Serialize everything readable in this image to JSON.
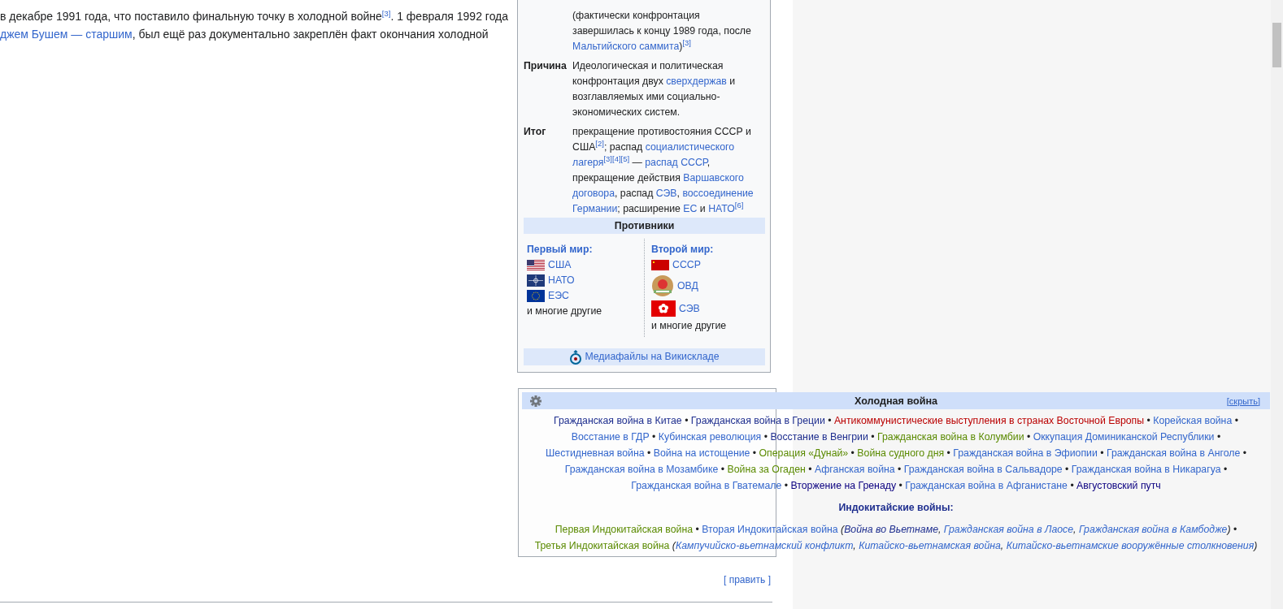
{
  "article": {
    "lines": [
      [
        {
          "kind": "text",
          "text": "в декабре 1991 года, что поставило финальную точку в холодной войне"
        },
        {
          "kind": "ref",
          "text": "[3]"
        },
        {
          "kind": "text",
          "text": ". 1 февраля 1992 года"
        }
      ],
      [
        {
          "kind": "link",
          "text": "джем Бушем — старшим"
        },
        {
          "kind": "text",
          "text": ", был ещё раз документально закреплён факт окончания холодной"
        }
      ]
    ]
  },
  "infobox": {
    "rows": [
      {
        "runs": [
          {
            "kind": "text",
            "text": "(фактически конфронтация завершилась к концу 1989 года, после "
          },
          {
            "kind": "link",
            "text": "Мальтийского саммита"
          },
          {
            "kind": "text",
            "text": ")"
          },
          {
            "kind": "ref",
            "text": "[3]"
          }
        ]
      },
      {
        "label": "Причина",
        "runs": [
          {
            "kind": "text",
            "text": "Идеологическая и политическая конфронтация двух "
          },
          {
            "kind": "link",
            "text": "сверхдержав"
          },
          {
            "kind": "text",
            "text": " и возглавляемых ими социально-экономических систем."
          }
        ]
      },
      {
        "label": "Итог",
        "runs": [
          {
            "kind": "text",
            "text": "прекращение противостояния СССР и США"
          },
          {
            "kind": "ref",
            "text": "[2]"
          },
          {
            "kind": "text",
            "text": "; распад "
          },
          {
            "kind": "link",
            "text": "социалистического "
          },
          {
            "kind": "link",
            "text": "лагеря"
          },
          {
            "kind": "ref",
            "text": "[3]"
          },
          {
            "kind": "ref",
            "text": "[4]"
          },
          {
            "kind": "ref",
            "text": "[5]"
          },
          {
            "kind": "text",
            "text": " — "
          },
          {
            "kind": "link",
            "text": "распад СССР"
          },
          {
            "kind": "text",
            "text": ", прекращение действия "
          },
          {
            "kind": "link",
            "text": "Варшавского "
          },
          {
            "kind": "link",
            "text": "договора"
          },
          {
            "kind": "text",
            "text": ", распад "
          },
          {
            "kind": "link",
            "text": "СЭВ"
          },
          {
            "kind": "text",
            "text": ", "
          },
          {
            "kind": "link",
            "text": "воссоединение "
          },
          {
            "kind": "link",
            "text": "Германии"
          },
          {
            "kind": "text",
            "text": "; расширение "
          },
          {
            "kind": "link",
            "text": "ЕС"
          },
          {
            "kind": "text",
            "text": " и "
          },
          {
            "kind": "link",
            "text": "НАТО"
          },
          {
            "kind": "ref",
            "text": "[6]"
          }
        ]
      }
    ],
    "opponents": {
      "title": "Противники",
      "sides": [
        {
          "heading": "Первый мир:",
          "items": [
            {
              "name": "США",
              "kind": "stripes"
            },
            {
              "name": "НАТО",
              "kind": "compass"
            },
            {
              "name": "ЕЭС",
              "kind": "stars"
            }
          ],
          "note": "и многие другие"
        },
        {
          "heading": "Второй мир:",
          "items": [
            {
              "name": "СССР",
              "kind": "red"
            },
            {
              "name": "ОВД",
              "kind": "emblem"
            },
            {
              "name": "СЭВ",
              "kind": "flower"
            }
          ],
          "note": "и многие другие"
        }
      ]
    },
    "media": {
      "label": "Медиафайлы на Викискладе"
    }
  },
  "navbox": {
    "title": "Холодная война",
    "toggle": "[скрыть]",
    "lines": [
      [
        {
          "kind": "link",
          "text": "Гражданская война в Китае",
          "color": "#1f2f8f"
        },
        {
          "kind": "text",
          "text": " • "
        },
        {
          "kind": "link",
          "text": "Гражданская война в Греции",
          "color": "#1f2f8f"
        },
        {
          "kind": "text",
          "text": " • "
        },
        {
          "kind": "link",
          "text": "Антикоммунистические выступления в странах Восточной Европы",
          "color": "#ba0000"
        },
        {
          "kind": "text",
          "text": " • "
        },
        {
          "kind": "link",
          "text": "Корейская война",
          "color": "#3366cc"
        },
        {
          "kind": "text",
          "text": " •"
        }
      ],
      [
        {
          "kind": "link",
          "text": "Восстание в ГДР",
          "color": "#3366cc"
        },
        {
          "kind": "text",
          "text": " • "
        },
        {
          "kind": "link",
          "text": "Кубинская революция",
          "color": "#3366cc"
        },
        {
          "kind": "text",
          "text": " • "
        },
        {
          "kind": "link",
          "text": "Восстание в Венгрии",
          "color": "#1f2f8f"
        },
        {
          "kind": "text",
          "text": " • "
        },
        {
          "kind": "link",
          "text": "Гражданская война в Колумбии",
          "color": "#5a8a00"
        },
        {
          "kind": "text",
          "text": " • "
        },
        {
          "kind": "link",
          "text": "Оккупация Доминиканской Республики",
          "color": "#3366cc"
        },
        {
          "kind": "text",
          "text": " •"
        }
      ],
      [
        {
          "kind": "link",
          "text": "Шестидневная война",
          "color": "#3366cc"
        },
        {
          "kind": "text",
          "text": " • "
        },
        {
          "kind": "link",
          "text": "Война на истощение",
          "color": "#3366cc"
        },
        {
          "kind": "text",
          "text": " • "
        },
        {
          "kind": "link",
          "text": "Операция «Дунай»",
          "color": "#5a8a00"
        },
        {
          "kind": "text",
          "text": " • "
        },
        {
          "kind": "link",
          "text": "Война судного дня",
          "color": "#5a8a00"
        },
        {
          "kind": "text",
          "text": " • "
        },
        {
          "kind": "link",
          "text": "Гражданская война в Эфиопии",
          "color": "#3366cc"
        },
        {
          "kind": "text",
          "text": " • "
        },
        {
          "kind": "link",
          "text": "Гражданская война в Анголе",
          "color": "#3366cc"
        },
        {
          "kind": "text",
          "text": " •"
        }
      ],
      [
        {
          "kind": "link",
          "text": "Гражданская война в Мозамбике",
          "color": "#3366cc"
        },
        {
          "kind": "text",
          "text": " • "
        },
        {
          "kind": "link",
          "text": "Война за Огаден",
          "color": "#5a8a00"
        },
        {
          "kind": "text",
          "text": " • "
        },
        {
          "kind": "link",
          "text": "Афганская война",
          "color": "#3366cc"
        },
        {
          "kind": "text",
          "text": " • "
        },
        {
          "kind": "link",
          "text": "Гражданская война в Сальвадоре",
          "color": "#3366cc"
        },
        {
          "kind": "text",
          "text": " • "
        },
        {
          "kind": "link",
          "text": "Гражданская война в Никарагуа",
          "color": "#3366cc"
        },
        {
          "kind": "text",
          "text": " •"
        }
      ],
      [
        {
          "kind": "link",
          "text": "Гражданская война в Гватемале",
          "color": "#3366cc"
        },
        {
          "kind": "text",
          "text": " • "
        },
        {
          "kind": "link",
          "text": "Вторжение на Гренаду",
          "color": "#0b0080"
        },
        {
          "kind": "text",
          "text": " • "
        },
        {
          "kind": "link",
          "text": "Гражданская война в Афганистане",
          "color": "#3366cc"
        },
        {
          "kind": "text",
          "text": " • "
        },
        {
          "kind": "link",
          "text": "Августовский путч",
          "color": "#0b0080"
        }
      ]
    ],
    "sections": [
      {
        "heading": "Индокитайские войны:",
        "lines": [
          [
            {
              "kind": "link",
              "text": "Первая Индокитайская война",
              "color": "#5a8a00"
            },
            {
              "kind": "text",
              "text": " • "
            },
            {
              "kind": "link",
              "text": "Вторая Индокитайская война",
              "color": "#3366cc"
            },
            {
              "kind": "note",
              "text": " ("
            },
            {
              "kind": "sublink",
              "text": "Война во Вьетнаме",
              "color": "#1f2f8f"
            },
            {
              "kind": "note",
              "text": ", "
            },
            {
              "kind": "sublink",
              "text": "Гражданская война в Лаосе",
              "color": "#3366cc"
            },
            {
              "kind": "note",
              "text": ", "
            },
            {
              "kind": "sublink",
              "text": "Гражданская война в Камбодже",
              "color": "#3366cc"
            },
            {
              "kind": "note",
              "text": ")"
            },
            {
              "kind": "text",
              "text": " •"
            }
          ],
          [
            {
              "kind": "link",
              "text": "Третья Индокитайская война",
              "color": "#5a8a00"
            },
            {
              "kind": "note",
              "text": " ("
            },
            {
              "kind": "sublink",
              "text": "Кампучийско-вьетнамский конфликт",
              "color": "#3366cc"
            },
            {
              "kind": "note",
              "text": ", "
            },
            {
              "kind": "sublink",
              "text": "Китайско-вьетнамская война",
              "color": "#3366cc"
            },
            {
              "kind": "note",
              "text": ", "
            },
            {
              "kind": "sublink",
              "text": "Китайско-вьетнамские вооружённые столкновения",
              "color": "#3366cc"
            },
            {
              "kind": "note",
              "text": ")"
            }
          ]
        ]
      }
    ]
  },
  "edit_link": "[ править ]"
}
